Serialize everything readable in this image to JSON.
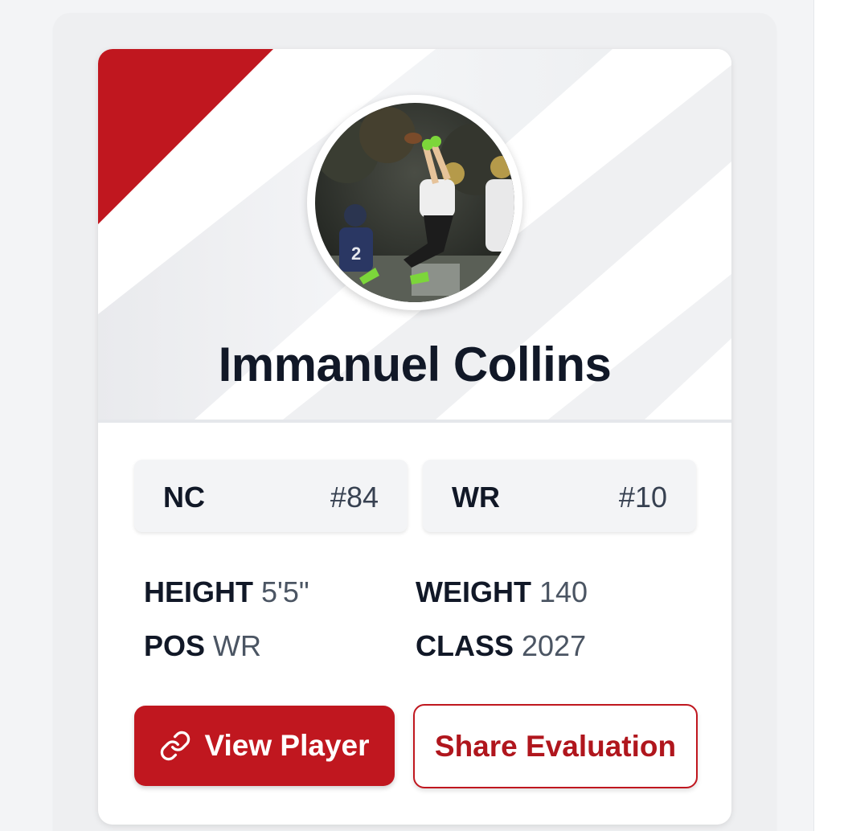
{
  "colors": {
    "accent_red": "#c0171f",
    "name_text": "#111827",
    "muted_text": "#4b5563",
    "page_bg": "#f3f4f6"
  },
  "player": {
    "name": "Immanuel Collins",
    "photo_alt": "Player catching a football"
  },
  "rankings": [
    {
      "label": "NC",
      "number": "#84"
    },
    {
      "label": "WR",
      "number": "#10"
    }
  ],
  "stats": {
    "height": {
      "label": "HEIGHT",
      "value": "5'5\""
    },
    "weight": {
      "label": "WEIGHT",
      "value": "140"
    },
    "position": {
      "label": "POS",
      "value": "WR"
    },
    "class": {
      "label": "CLASS",
      "value": "2027"
    }
  },
  "actions": {
    "view_player": {
      "label": "View Player",
      "icon": "link-icon"
    },
    "share_evaluation": {
      "label": "Share Evaluation"
    }
  }
}
